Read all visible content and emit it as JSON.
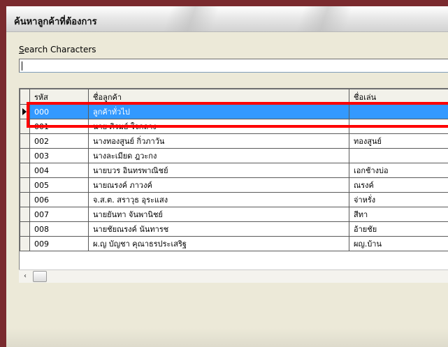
{
  "window": {
    "title": "ค้นหาลูกค้าที่ต้องการ"
  },
  "search": {
    "label_mnemonic": "S",
    "label_rest": "earch Characters",
    "value": "",
    "placeholder": ""
  },
  "grid": {
    "columns": [
      "รหัส",
      "ชื่อลูกค้า",
      "ชื่อเล่น"
    ],
    "selected_row": 0,
    "rows": [
      {
        "code": "000",
        "name": "ลูกค้าทั่วไป",
        "nick": ""
      },
      {
        "code": "001",
        "name": "นาย ภิรมย์ ใจกลาง",
        "nick": ""
      },
      {
        "code": "002",
        "name": "นางทองสูนย์ กิ่วภาวัน",
        "nick": "ทองสูนย์"
      },
      {
        "code": "003",
        "name": "นางละเมียด ฎวะกง",
        "nick": ""
      },
      {
        "code": "004",
        "name": "นายบวร อินทรพาณิชย์",
        "nick": "เอกช้างบ่อ"
      },
      {
        "code": "005",
        "name": "นายณรงค์ ภาวงค์",
        "nick": "ณรงค์"
      },
      {
        "code": "006",
        "name": "จ.ส.ต. สราวุธ อุระแสง",
        "nick": "จ่าหรั่ง"
      },
      {
        "code": "007",
        "name": "นายยันทา จันพานิชย์",
        "nick": "สีทา"
      },
      {
        "code": "008",
        "name": "นายชัยณรงค์ นันทารช",
        "nick": "อ้ายชัย"
      },
      {
        "code": "009",
        "name": "ผ.ญ บัญชา คุณาธรประเสริฐ",
        "nick": "ผญ.บ้าน"
      }
    ]
  },
  "colors": {
    "selection": "#3399ff",
    "highlight_box": "#ff0000"
  },
  "scrollbar": {
    "left_arrow": "‹"
  }
}
